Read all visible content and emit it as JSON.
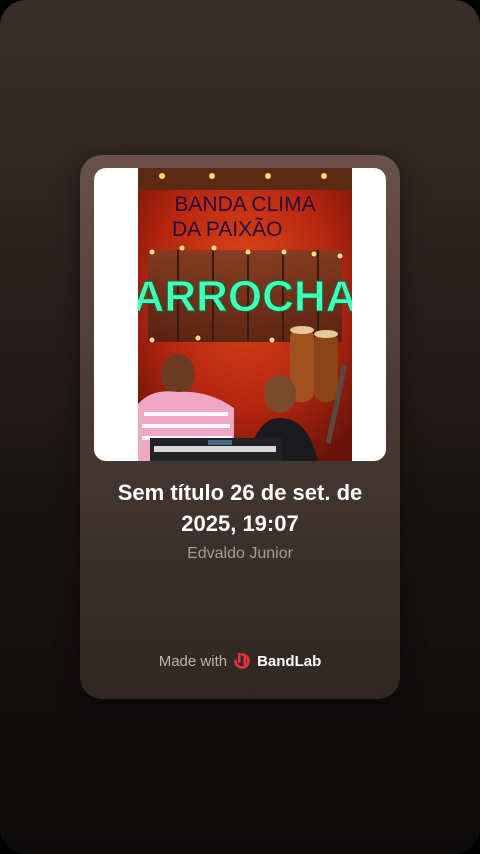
{
  "cover": {
    "band_line1": "BANDA CLIMA",
    "band_line2": "DA PAIXÃO",
    "genre": "ARROCHA"
  },
  "track": {
    "title": "Sem título 26 de set. de 2025, 19:07",
    "artist": "Edvaldo Junior"
  },
  "footer": {
    "made_with": "Made with",
    "brand": "BandLab",
    "brand_icon": "bandlab-logo-icon"
  },
  "colors": {
    "brand_red": "#f0313b",
    "neon_green": "#47ffb2",
    "title_text": "#ffffff",
    "artist_text": "#a89a94"
  }
}
